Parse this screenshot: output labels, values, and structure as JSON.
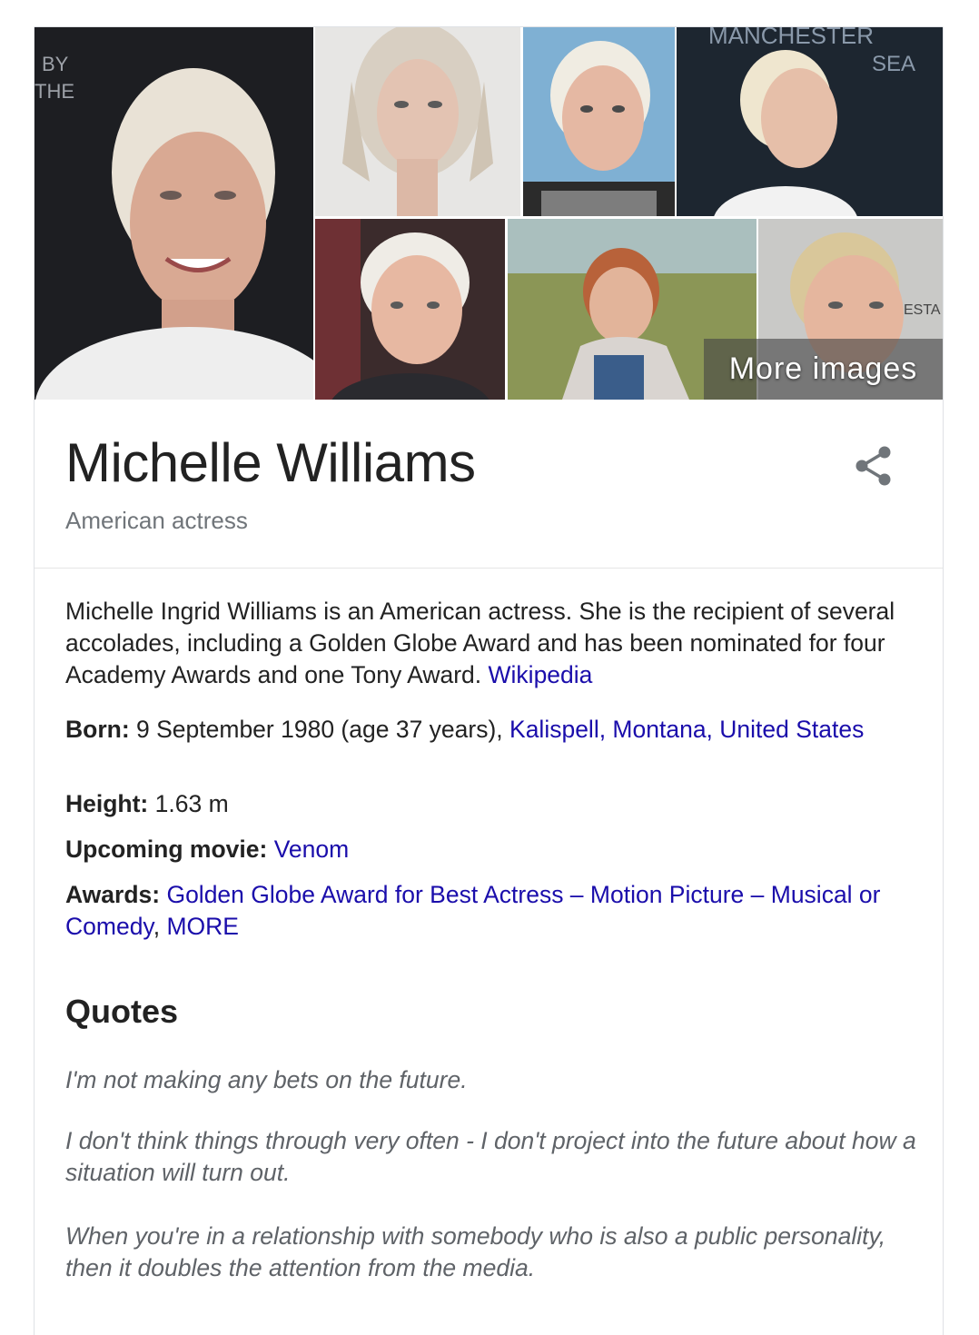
{
  "images": {
    "more_images_label": "More images",
    "backdrop_text_1": "BY\nTHE",
    "backdrop_text_4": "MANCHESTER\nSEA",
    "backdrop_text_7": "ESTA"
  },
  "entity": {
    "name": "Michelle Williams",
    "type": "American actress"
  },
  "description": {
    "text": "Michelle Ingrid Williams is an American actress. She is the recipient of several accolades, including a Golden Globe Award and has been nominated for four Academy Awards and one Tony Award. ",
    "source_link": "Wikipedia"
  },
  "facts": {
    "born": {
      "label": "Born:",
      "value": " 9 September 1980 (age 37 years), ",
      "link": "Kalispell, Montana, United States"
    },
    "height": {
      "label": "Height:",
      "value": " 1.63 m"
    },
    "upcoming_movie": {
      "label": "Upcoming movie:",
      "link": "Venom"
    },
    "awards": {
      "label": "Awards:",
      "link": "Golden Globe Award for Best Actress – Motion Picture – Musical or Comedy",
      "separator": ", ",
      "more_link": "MORE"
    }
  },
  "quotes": {
    "heading": "Quotes",
    "items": [
      "I'm not making any bets on the future.",
      "I don't think things through very often - I don't project into the future about how a situation will turn out.",
      "When you're in a relationship with somebody who is also a public personality, then it doubles the attention from the media."
    ]
  },
  "colors": {
    "link": "#1a0dab",
    "muted": "#70757a",
    "quote": "#5f6368",
    "text": "#222222"
  },
  "icons": {
    "share": "share-icon"
  }
}
